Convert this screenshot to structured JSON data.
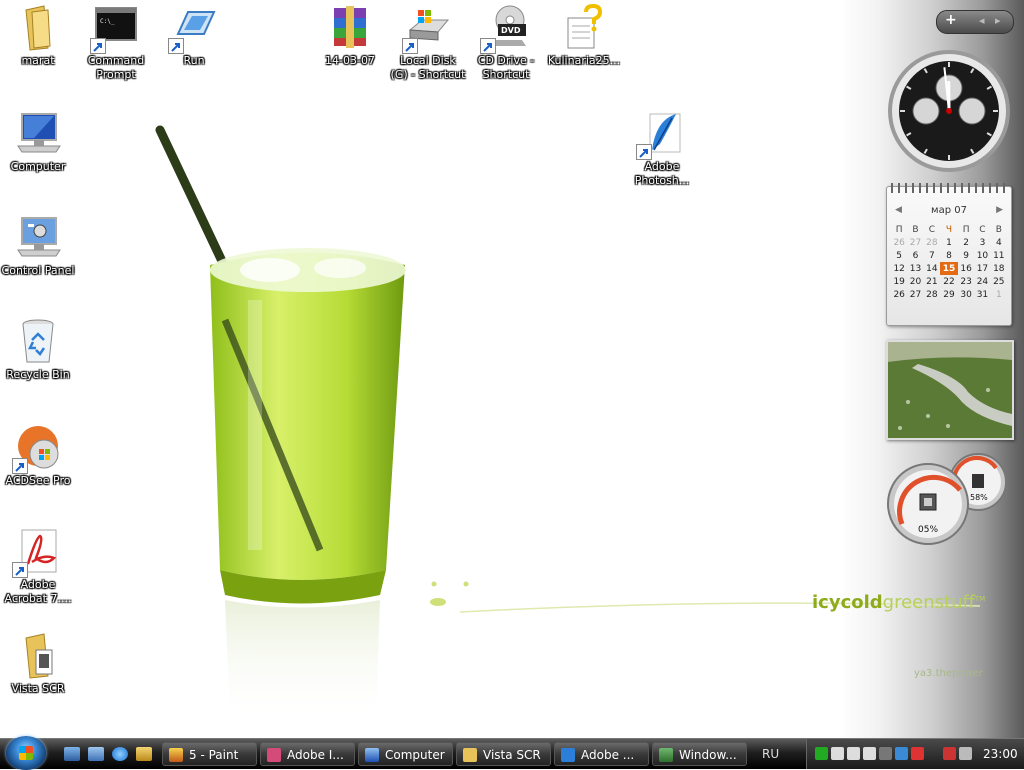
{
  "desktop": {
    "icons": [
      {
        "label": "marat"
      },
      {
        "label": "Command Prompt"
      },
      {
        "label": "Run"
      },
      {
        "label": "14-03-07"
      },
      {
        "label": "Local Disk (G) - Shortcut"
      },
      {
        "label": "CD Drive - Shortcut"
      },
      {
        "label": "Kulinaria25..."
      },
      {
        "label": "Computer"
      },
      {
        "label": "Control Panel"
      },
      {
        "label": "Recycle Bin"
      },
      {
        "label": "ACDSee Pro"
      },
      {
        "label": "Adobe Acrobat 7...."
      },
      {
        "label": "Vista SCR"
      },
      {
        "label": "Adobe Photosh..."
      }
    ],
    "dvd_badge": "DVD",
    "cmd_glyph": "C:\\_",
    "brand_bold": "icycold",
    "brand_light": "greenstuff",
    "brand_tm": "TM",
    "tagline": "ya3.thepower"
  },
  "sidebar": {
    "controls": {
      "add": "+",
      "prev": "◂",
      "next": "▸"
    },
    "clock": {
      "hour": 11,
      "minute": 59
    },
    "calendar": {
      "month": "мар 07",
      "weekdays": [
        "П",
        "В",
        "С",
        "Ч",
        "П",
        "С",
        "В"
      ],
      "weeks": [
        [
          "26",
          "27",
          "28",
          "1",
          "2",
          "3",
          "4"
        ],
        [
          "5",
          "6",
          "7",
          "8",
          "9",
          "10",
          "11"
        ],
        [
          "12",
          "13",
          "14",
          "15",
          "16",
          "17",
          "18"
        ],
        [
          "19",
          "20",
          "21",
          "22",
          "23",
          "24",
          "25"
        ],
        [
          "26",
          "27",
          "28",
          "29",
          "30",
          "31",
          "1"
        ]
      ],
      "today": "15"
    },
    "meters": {
      "cpu": "05%",
      "memory": "58%"
    }
  },
  "taskbar": {
    "items": [
      {
        "label": "5 - Paint"
      },
      {
        "label": "Adobe I..."
      },
      {
        "label": "Computer"
      },
      {
        "label": "Vista SCR"
      },
      {
        "label": "Adobe ..."
      },
      {
        "label": "Window..."
      }
    ],
    "language": "RU",
    "time": "23:00"
  },
  "colors": {
    "accent": "#8dab1a",
    "today": "#e36b14",
    "taskbar": "#1f1f1f"
  }
}
